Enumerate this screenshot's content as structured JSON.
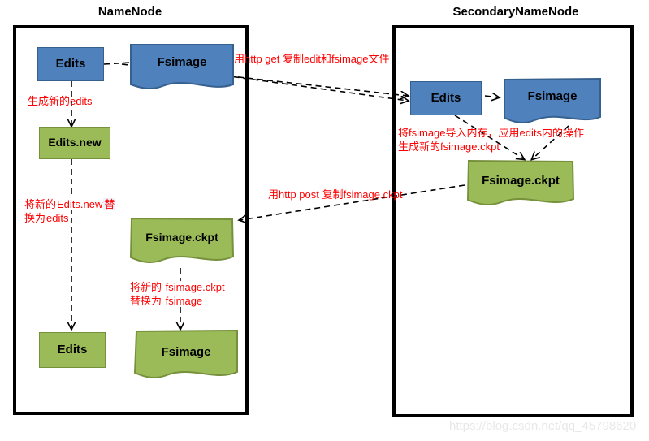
{
  "diagram": {
    "title_left": "NameNode",
    "title_right": "SecondaryNameNode",
    "watermark": "https://blog.csdn.net/qq_45798620"
  },
  "namenode": {
    "boxes": [
      {
        "id": "nn-edits-top",
        "label": "Edits",
        "style": "blue-rect"
      },
      {
        "id": "nn-fsimage-top",
        "label": "Fsimage",
        "style": "blue-doc"
      },
      {
        "id": "nn-edits-new",
        "label": "Edits.new",
        "style": "green-rect"
      },
      {
        "id": "nn-fsimage-ckpt",
        "label": "Fsimage.ckpt",
        "style": "green-doc"
      },
      {
        "id": "nn-edits-final",
        "label": "Edits",
        "style": "green-rect"
      },
      {
        "id": "nn-fsimage-final",
        "label": "Fsimage",
        "style": "green-doc"
      }
    ],
    "annotations": {
      "gen_new_edits": "生成新的edits",
      "replace_edits_line1_a": "将新的",
      "replace_edits_line1_b": "Edits.new",
      "replace_edits_line1_c": "替",
      "replace_edits_line2_a": "换为",
      "replace_edits_line2_b": "edits",
      "replace_fsimage_line1_a": "将新的",
      "replace_fsimage_line1_b": "fsimage.ckpt",
      "replace_fsimage_line2_a": "替换为",
      "replace_fsimage_line2_b": "fsimage"
    }
  },
  "secondarynamenode": {
    "boxes": [
      {
        "id": "snn-edits",
        "label": "Edits",
        "style": "blue-rect"
      },
      {
        "id": "snn-fsimage",
        "label": "Fsimage",
        "style": "blue-doc"
      },
      {
        "id": "snn-fsimage-ckpt",
        "label": "Fsimage.ckpt",
        "style": "green-doc"
      }
    ],
    "annotations": {
      "merge_line1": "将fsimage导入内存，应用edits内的操作",
      "merge_line2": "生成新的fsimage.ckpt"
    }
  },
  "transfers": {
    "http_get": "用http get 复制edit和fsimage文件",
    "http_post": "用http post 复制fsimage.ckpt"
  },
  "colors": {
    "blue_fill": "#4f81bd",
    "blue_border": "#36618e",
    "green_fill": "#9bbb59",
    "green_border": "#76903c",
    "annotation_red": "#ff0000",
    "frame_black": "#000000"
  }
}
